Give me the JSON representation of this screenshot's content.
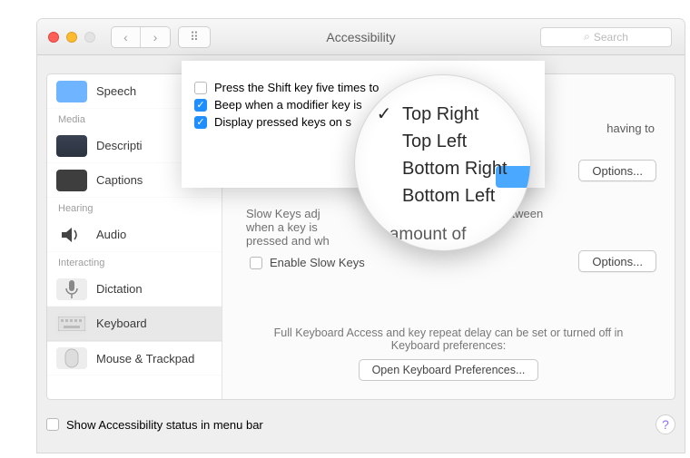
{
  "window": {
    "title": "Accessibility"
  },
  "search": {
    "placeholder": "Search"
  },
  "sidebar": {
    "sections": [
      {
        "header": "",
        "items": [
          {
            "label": "Speech",
            "icon": "speech-bubble-icon"
          }
        ]
      },
      {
        "header": "Media",
        "items": [
          {
            "label": "Descripti",
            "icon": "descriptions-icon"
          },
          {
            "label": "Captions",
            "icon": "captions-icon"
          }
        ]
      },
      {
        "header": "Hearing",
        "items": [
          {
            "label": "Audio",
            "icon": "speaker-icon"
          }
        ]
      },
      {
        "header": "Interacting",
        "items": [
          {
            "label": "Dictation",
            "icon": "microphone-icon"
          },
          {
            "label": "Keyboard",
            "icon": "keyboard-icon",
            "selected": true
          },
          {
            "label": "Mouse & Trackpad",
            "icon": "mouse-icon"
          }
        ]
      }
    ]
  },
  "panel": {
    "sticky": {
      "press_shift": {
        "label": "Press the Shift key five times to",
        "checked": false
      },
      "beep": {
        "label": "Beep when a modifier key is",
        "checked": true
      },
      "display": {
        "label": "Display pressed keys on s",
        "checked": true
      },
      "trailing": "having to",
      "options": "Options..."
    },
    "slow": {
      "desc_1": "Slow Keys adj",
      "desc_2": "etween when a key is",
      "desc_3": "pressed and wh",
      "enable": {
        "label": "Enable Slow Keys",
        "checked": false
      },
      "options": "Options..."
    },
    "footer": {
      "text": "Full Keyboard Access and key repeat delay can be set or turned off in\nKeyboard preferences:",
      "button": "Open Keyboard Preferences..."
    }
  },
  "zoom_menu": {
    "items": [
      {
        "label": "Top Right",
        "checked": true
      },
      {
        "label": "Top Left",
        "checked": false
      },
      {
        "label": "Bottom Right",
        "checked": false
      },
      {
        "label": "Bottom Left",
        "checked": false
      }
    ],
    "ghost_text": "s",
    "extra_text": "e amount of"
  },
  "bottom": {
    "show_status": {
      "label": "Show Accessibility status in menu bar",
      "checked": false
    }
  },
  "colors": {
    "accent": "#1f8fff"
  }
}
